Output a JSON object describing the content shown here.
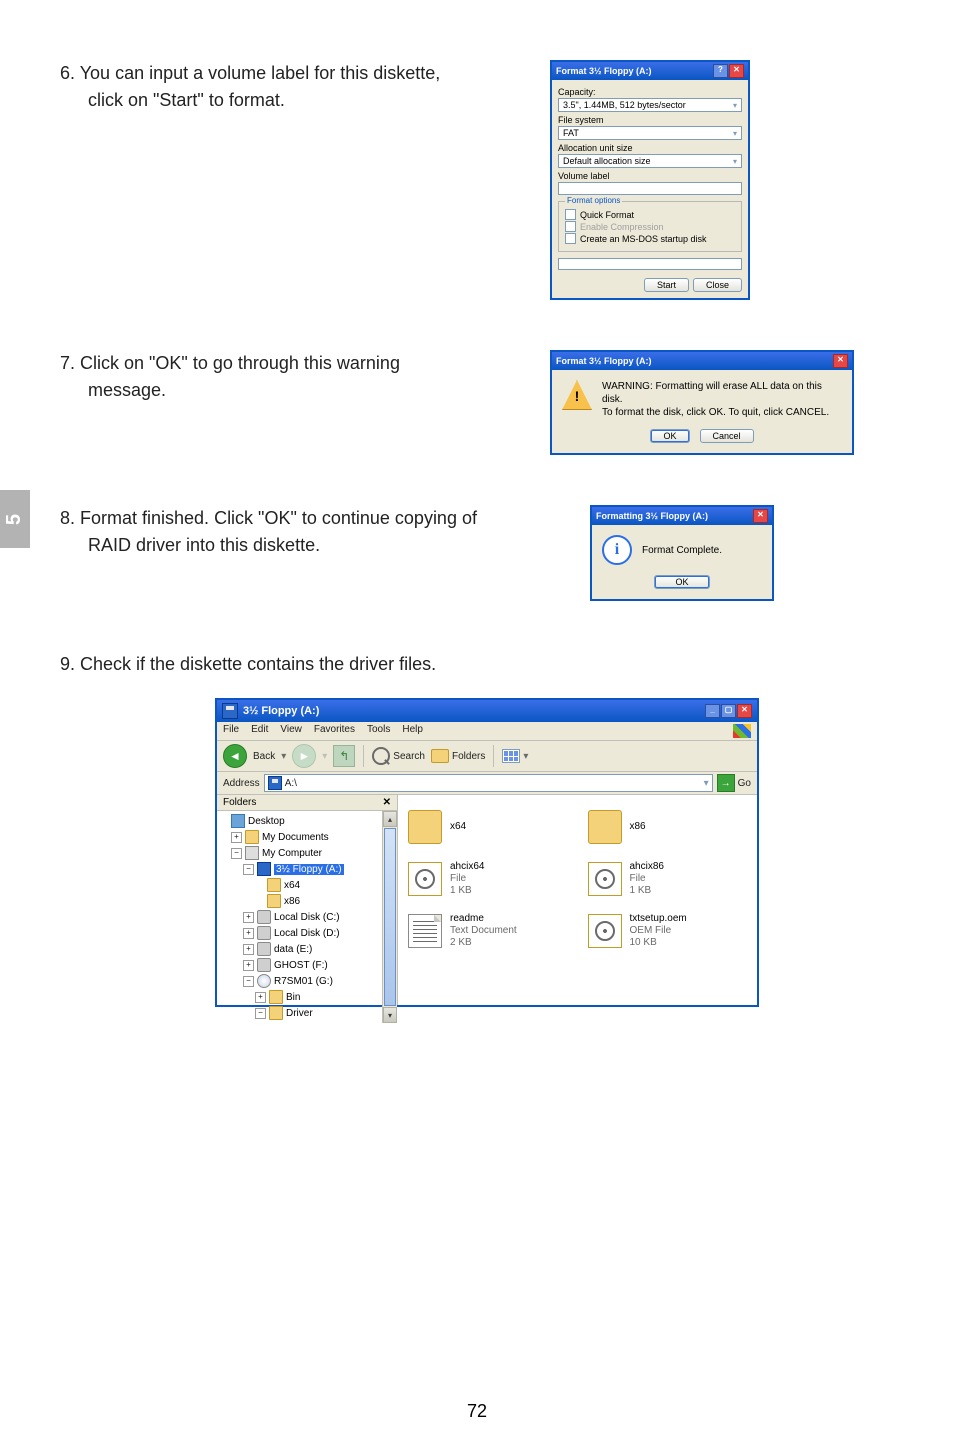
{
  "side_tab": "5",
  "page_number": "72",
  "steps": {
    "s6_line1": "6. You can input a volume label for this diskette,",
    "s6_line2": "click on \"Start\" to format.",
    "s7_line1": "7. Click on \"OK\" to go through this warning",
    "s7_line2": "message.",
    "s8_line1": "8. Format finished. Click \"OK\" to continue copying of",
    "s8_line2": "RAID driver into this diskette.",
    "s9": "9. Check if the diskette contains the driver files."
  },
  "format_dialog": {
    "title": "Format 3½ Floppy (A:)",
    "capacity_label": "Capacity:",
    "capacity_val": "3.5\", 1.44MB, 512 bytes/sector",
    "fs_label": "File system",
    "fs_val": "FAT",
    "alloc_label": "Allocation unit size",
    "alloc_val": "Default allocation size",
    "volume_label": "Volume label",
    "options_title": "Format options",
    "quick": "Quick Format",
    "compression": "Enable Compression",
    "msdos": "Create an MS-DOS startup disk",
    "start": "Start",
    "close": "Close"
  },
  "warning_dialog": {
    "title": "Format 3½ Floppy (A:)",
    "line1": "WARNING: Formatting will erase ALL data on this disk.",
    "line2": "To format the disk, click OK. To quit, click CANCEL.",
    "ok": "OK",
    "cancel": "Cancel"
  },
  "info_dialog": {
    "title": "Formatting 3½ Floppy (A:)",
    "msg": "Format Complete.",
    "ok": "OK"
  },
  "explorer": {
    "title": "3½ Floppy (A:)",
    "menu": {
      "file": "File",
      "edit": "Edit",
      "view": "View",
      "favorites": "Favorites",
      "tools": "Tools",
      "help": "Help"
    },
    "back": "Back",
    "search": "Search",
    "folders": "Folders",
    "address_label": "Address",
    "address_val": "A:\\",
    "go": "Go",
    "folders_header": "Folders",
    "tree": {
      "desktop": "Desktop",
      "mydocs": "My Documents",
      "mycomp": "My Computer",
      "floppy": "3½ Floppy (A:)",
      "x64": "x64",
      "x86": "x86",
      "localc": "Local Disk (C:)",
      "locald": "Local Disk (D:)",
      "datae": "data (E:)",
      "ghostf": "GHOST (F:)",
      "r7smg": "R7SM01 (G:)",
      "bin": "Bin",
      "driver": "Driver"
    },
    "files": {
      "f1_name": "x64",
      "f2_name": "x86",
      "f3_name": "ahcix64",
      "f3_l2": "File",
      "f3_l3": "1 KB",
      "f4_name": "ahcix86",
      "f4_l2": "File",
      "f4_l3": "1 KB",
      "f5_name": "readme",
      "f5_l2": "Text Document",
      "f5_l3": "2 KB",
      "f6_name": "txtsetup.oem",
      "f6_l2": "OEM File",
      "f6_l3": "10 KB"
    }
  }
}
